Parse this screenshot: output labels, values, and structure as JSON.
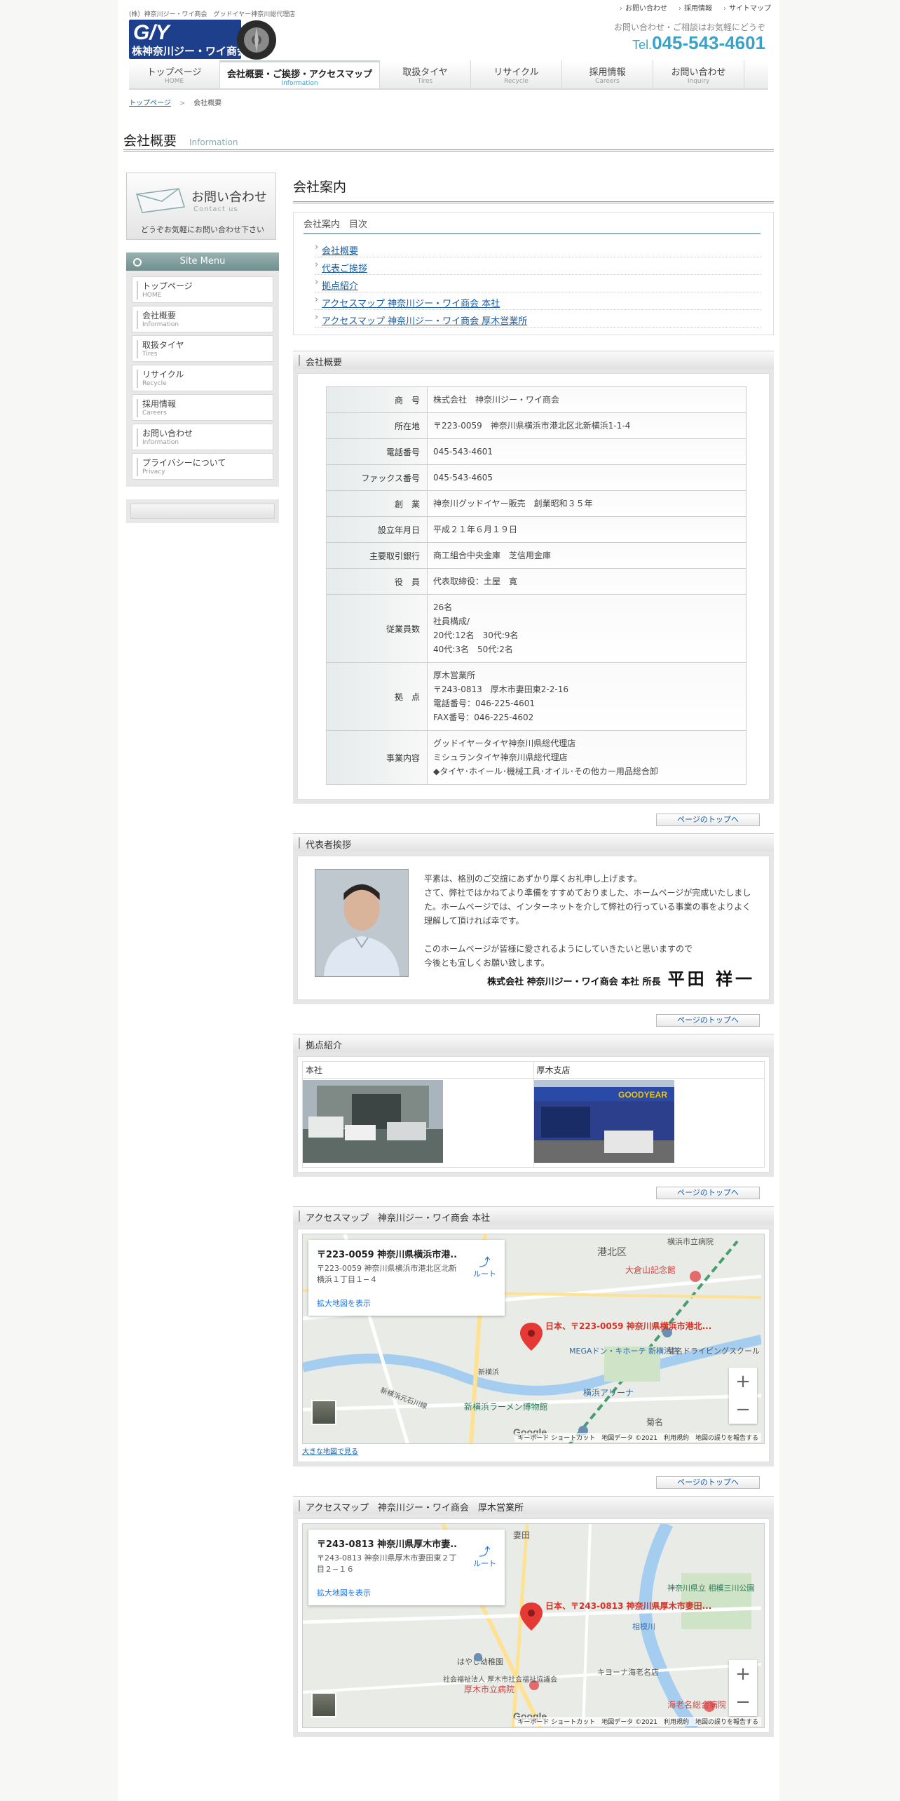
{
  "header": {
    "tagline": "(株）神奈川ジー・ワイ商会　グッドイヤー神奈川総代理店",
    "logo_text": "GY 株神奈川ジー・ワイ商会",
    "top_links": [
      "お問い合わせ",
      "採用情報",
      "サイトマップ"
    ],
    "contact_note": "お問い合わせ・ご相談はお気軽にどうぞ",
    "tel_prefix": "Tel.",
    "tel_number": "045-543-4601"
  },
  "nav": [
    {
      "jp": "トップページ",
      "en": "HOME"
    },
    {
      "jp": "会社概要・ご挨拶・アクセスマップ",
      "en": "Information"
    },
    {
      "jp": "取扱タイヤ",
      "en": "Tires"
    },
    {
      "jp": "リサイクル",
      "en": "Recycle"
    },
    {
      "jp": "採用情報",
      "en": "Careers"
    },
    {
      "jp": "お問い合わせ",
      "en": "Inquiry"
    }
  ],
  "breadcrumb": {
    "home": "トップページ",
    "sep": ">",
    "current": "会社概要"
  },
  "page_title": {
    "jp": "会社概要",
    "en": "Information"
  },
  "sidebar": {
    "contact": {
      "title": "お問い合わせ",
      "en": "Contact us",
      "note": "どうぞお気軽にお問い合わせ下さい"
    },
    "menu_title": "Site Menu",
    "menu": [
      {
        "jp": "トップページ",
        "en": "HOME"
      },
      {
        "jp": "会社概要",
        "en": "Information"
      },
      {
        "jp": "取扱タイヤ",
        "en": "Tires"
      },
      {
        "jp": "リサイクル",
        "en": "Recycle"
      },
      {
        "jp": "採用情報",
        "en": "Careers"
      },
      {
        "jp": "お問い合わせ",
        "en": "Information"
      },
      {
        "jp": "プライバシーについて",
        "en": "Privacy"
      }
    ]
  },
  "main": {
    "heading": "会社案内",
    "toc_title": "会社案内　目次",
    "toc": [
      "会社概要",
      "代表ご挨拶",
      "拠点紹介",
      "アクセスマップ 神奈川ジー・ワイ商会 本社",
      "アクセスマップ 神奈川ジー・ワイ商会 厚木営業所"
    ],
    "overview_title": "会社概要",
    "overview": [
      {
        "k": "商　号",
        "v": "株式会社　神奈川ジー・ワイ商会"
      },
      {
        "k": "所在地",
        "v": "〒223-0059　神奈川県横浜市港北区北新横浜1-1-4"
      },
      {
        "k": "電話番号",
        "v": "045-543-4601"
      },
      {
        "k": "ファックス番号",
        "v": "045-543-4605"
      },
      {
        "k": "創　業",
        "v": "神奈川グッドイヤー販売　創業昭和３５年"
      },
      {
        "k": "設立年月日",
        "v": "平成２１年６月１９日"
      },
      {
        "k": "主要取引銀行",
        "v": "商工組合中央金庫　芝信用金庫"
      },
      {
        "k": "役　員",
        "v": "代表取締役：土屋　寛"
      },
      {
        "k": "従業員数",
        "lines": [
          "26名",
          "社員構成/",
          "20代:12名　30代:9名",
          "40代:3名　50代:2名"
        ]
      },
      {
        "k": "拠　点",
        "lines": [
          "厚木営業所",
          "〒243-0813　厚木市妻田東2-2-16",
          "電話番号：046-225-4601",
          "FAX番号：046-225-4602"
        ]
      },
      {
        "k": "事業内容",
        "lines": [
          "グッドイヤータイヤ神奈川県総代理店",
          "ミシュランタイヤ神奈川県総代理店",
          "◆タイヤ･ホイール･機械工具･オイル･その他カー用品総合卸"
        ]
      }
    ],
    "to_top": "ページのトップへ",
    "greeting_title": "代表者挨拶",
    "greeting_lines": [
      "平素は、格別のご交誼にあずかり厚くお礼申し上げます。",
      "さて、弊社ではかねてより準備をすすめておりました、ホームページが完成いたしまし",
      "た。ホームページでは、インターネットを介して弊社の行っている事業の事をよりよく",
      "理解して頂ければ幸です。",
      "",
      "このホームページが皆様に愛されるようにしていきたいと思いますので",
      "今後とも宜しくお願い致します。"
    ],
    "signature": "株式会社 神奈川ジー・ワイ商会 本社 所長",
    "signature_name": "平田 祥一",
    "bases_title": "拠点紹介",
    "bases": [
      "本社",
      "厚木支店"
    ],
    "map1": {
      "title": "アクセスマップ　神奈川ジー・ワイ商会 本社",
      "card_title": "〒223-0059 神奈川県横浜市港...",
      "card_addr": "〒223-0059 神奈川県横浜市港北区北新横浜１丁目１−４",
      "route": "ルート",
      "enlarge": "拡大地図を表示",
      "pin_label": "日本、〒223-0059 神奈川県横浜市港北...",
      "labels": [
        "港北区",
        "大倉山記念館",
        "新横浜",
        "新横浜ラーメン博物館",
        "横浜アリーナ",
        "菊名",
        "MEGAドン・キホーテ 新横浜店",
        "菊名ドライビングスクール",
        "横浜市立病院",
        "新横浜元石川線"
      ],
      "footer": "キーボード ショートカット　地図データ ©2021　利用規約　地図の誤りを報告する",
      "large_link": "大きな地図で見る"
    },
    "map2": {
      "title": "アクセスマップ　神奈川ジー・ワイ商会　厚木営業所",
      "card_title": "〒243-0813 神奈川県厚木市妻...",
      "card_addr": "〒243-0813 神奈川県厚木市妻田東２丁目２−１６",
      "route": "ルート",
      "enlarge": "拡大地図を表示",
      "pin_label": "日本、〒243-0813 神奈川県厚木市妻田...",
      "labels": [
        "妻田",
        "神奈川県立 相模三川公園",
        "はやし幼稚園",
        "厚木市立病院",
        "海老名総合病院",
        "キヨーナ海老名店",
        "相模川",
        "社会福祉法人 厚木市社会福祉協議会"
      ],
      "footer": "キーボード ショートカット　地図データ ©2021　利用規約　地図の誤りを報告する"
    }
  }
}
